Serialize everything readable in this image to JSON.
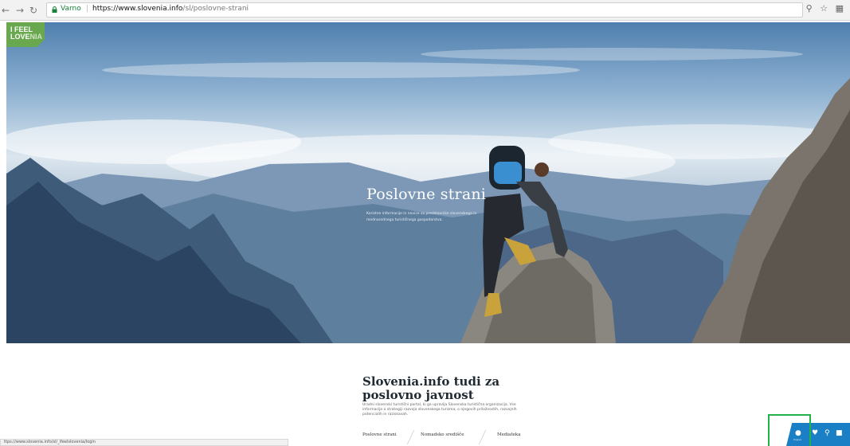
{
  "browser": {
    "secure_label": "Varno",
    "url_host": "https://www.slovenia.info",
    "url_path": "/sl/poslovne-strani"
  },
  "brand": {
    "line1": "I FEEL",
    "line2_a": "LOVE",
    "line2_b": "NIA"
  },
  "hero": {
    "title": "Poslovne strani",
    "subtitle": "Koristne informacije in novice za predstavnike slovenskega in mednarodnega turističnega gospodarstva."
  },
  "section": {
    "title_line1": "Slovenia.info tudi za",
    "title_line2": "poslovno javnost",
    "description": "Uradni slovenski turistični portal, ki ga upravlja Slovenska turistična organizacija. Vse informacije o strategiji razvoja slovenskega turizma, o njegovih priložnostih, razvojnih potencialih in raziskavah."
  },
  "subtabs": [
    {
      "label": "Poslovne strani"
    },
    {
      "label": "Nomadsko središče"
    },
    {
      "label": "Mediateka"
    }
  ],
  "status_bar": {
    "text": "ttps://www.slovenia.info/sl/_ifeelslovenia/login"
  },
  "float_bar": {
    "account_label": "Prijava"
  },
  "colors": {
    "brand_green": "#6aa84f",
    "float_blue": "#1a7fc4",
    "highlight_green": "#22b24c"
  }
}
